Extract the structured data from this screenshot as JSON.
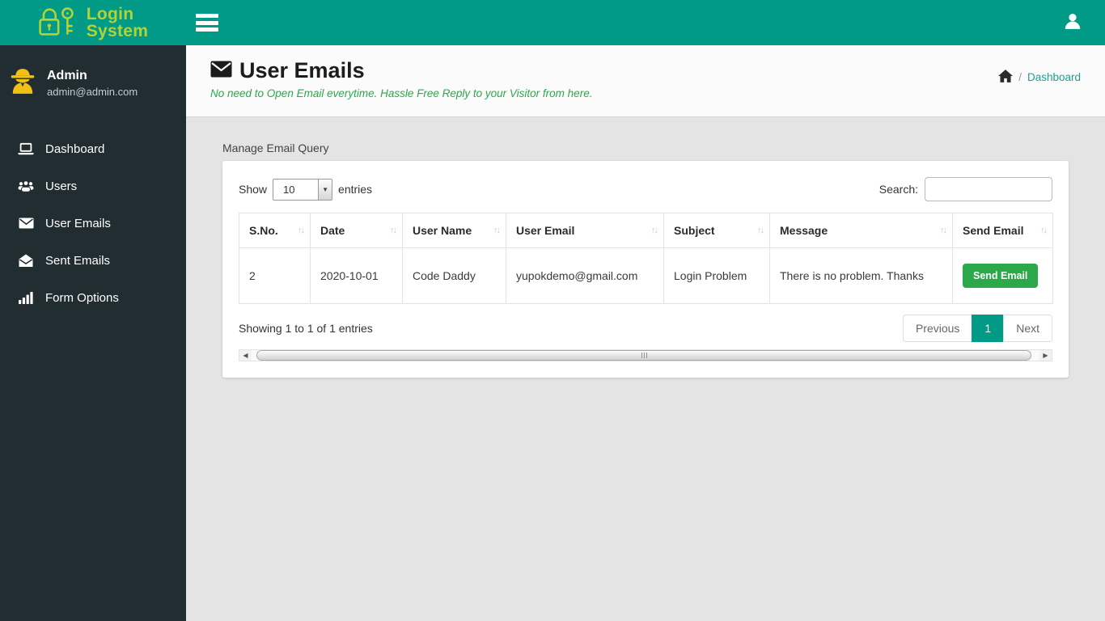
{
  "brand": {
    "line1": "Login",
    "line2": "System"
  },
  "user_panel": {
    "name": "Admin",
    "email": "admin@admin.com"
  },
  "sidebar": {
    "items": [
      {
        "label": "Dashboard"
      },
      {
        "label": "Users"
      },
      {
        "label": "User Emails"
      },
      {
        "label": "Sent Emails"
      },
      {
        "label": "Form Options"
      }
    ]
  },
  "page_header": {
    "title": "User Emails",
    "subtitle": "No need to Open Email everytime. Hassle Free Reply to your Visitor from here.",
    "breadcrumb_separator": "/",
    "breadcrumb_link": "Dashboard"
  },
  "content": {
    "panel_heading": "Manage Email Query"
  },
  "datatable": {
    "show_label": "Show",
    "page_size": "10",
    "entries_label": "entries",
    "search_label": "Search:",
    "search_value": "",
    "headers": [
      "S.No.",
      "Date",
      "User Name",
      "User Email",
      "Subject",
      "Message",
      "Send Email"
    ],
    "rows": [
      {
        "sno": "2",
        "date": "2020-10-01",
        "user_name": "Code Daddy",
        "user_email": "yupokdemo@gmail.com",
        "subject": "Login Problem",
        "message": "There is no problem. Thanks",
        "action": "Send Email"
      }
    ],
    "info": "Showing 1 to 1 of 1 entries",
    "pagination": {
      "previous": "Previous",
      "page": "1",
      "next": "Next"
    }
  },
  "colors": {
    "header_teal": "#019a87",
    "sidebar_dark": "#222d32",
    "logo_green": "#b2d235",
    "admin_gold": "#f0c014",
    "success_green": "#2aa84a",
    "breadcrumb_link_teal": "#1aa38f"
  }
}
